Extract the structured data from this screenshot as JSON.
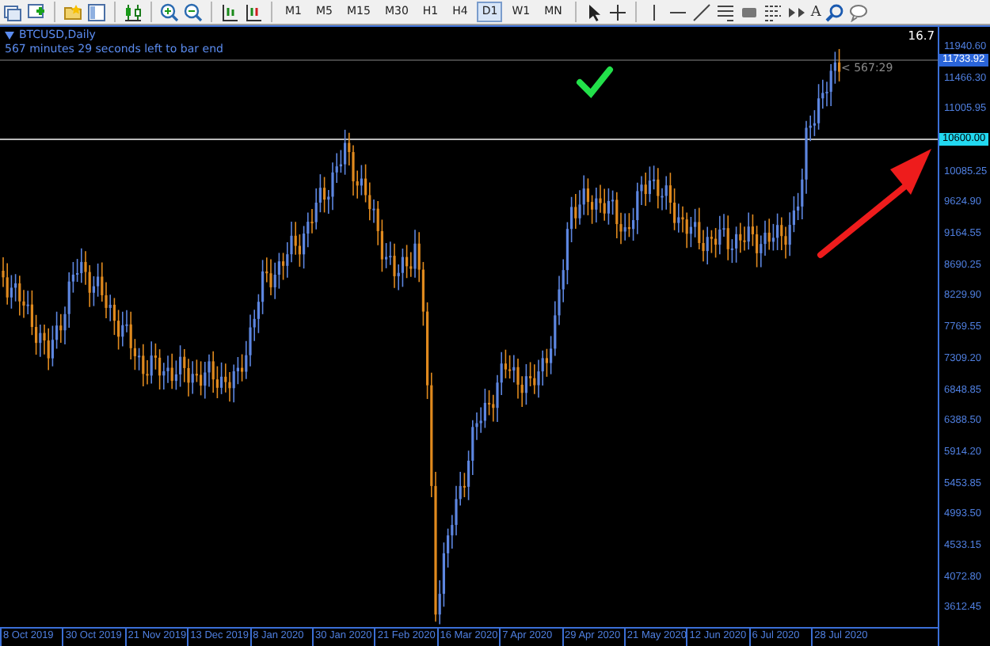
{
  "toolbar": {
    "timeframes": [
      {
        "label": "M1",
        "selected": false
      },
      {
        "label": "M5",
        "selected": false
      },
      {
        "label": "M15",
        "selected": false
      },
      {
        "label": "M30",
        "selected": false
      },
      {
        "label": "H1",
        "selected": false
      },
      {
        "label": "H4",
        "selected": false
      },
      {
        "label": "D1",
        "selected": true
      },
      {
        "label": "W1",
        "selected": false
      },
      {
        "label": "MN",
        "selected": false
      }
    ],
    "text_tool": "A"
  },
  "chart": {
    "symbol": "BTCUSD,Daily",
    "countdown": "567 minutes 29 seconds left to bar end",
    "corner_value": "16.7",
    "timer_label": "< 567:29",
    "current_price": "11733.92",
    "level_line_price": "10600.00",
    "price_axis": [
      "11940.60",
      "11466.30",
      "11005.95",
      "10085.25",
      "9624.90",
      "9164.55",
      "8690.25",
      "8229.90",
      "7769.55",
      "7309.20",
      "6848.85",
      "6388.50",
      "5914.20",
      "5453.85",
      "4993.50",
      "4533.15",
      "4072.80",
      "3612.45"
    ],
    "date_axis": [
      "8 Oct 2019",
      "30 Oct 2019",
      "21 Nov 2019",
      "13 Dec 2019",
      "8 Jan 2020",
      "30 Jan 2020",
      "21 Feb 2020",
      "16 Mar 2020",
      "7 Apr 2020",
      "29 Apr 2020",
      "21 May 2020",
      "12 Jun 2020",
      "6 Jul 2020",
      "28 Jul 2020"
    ]
  }
}
